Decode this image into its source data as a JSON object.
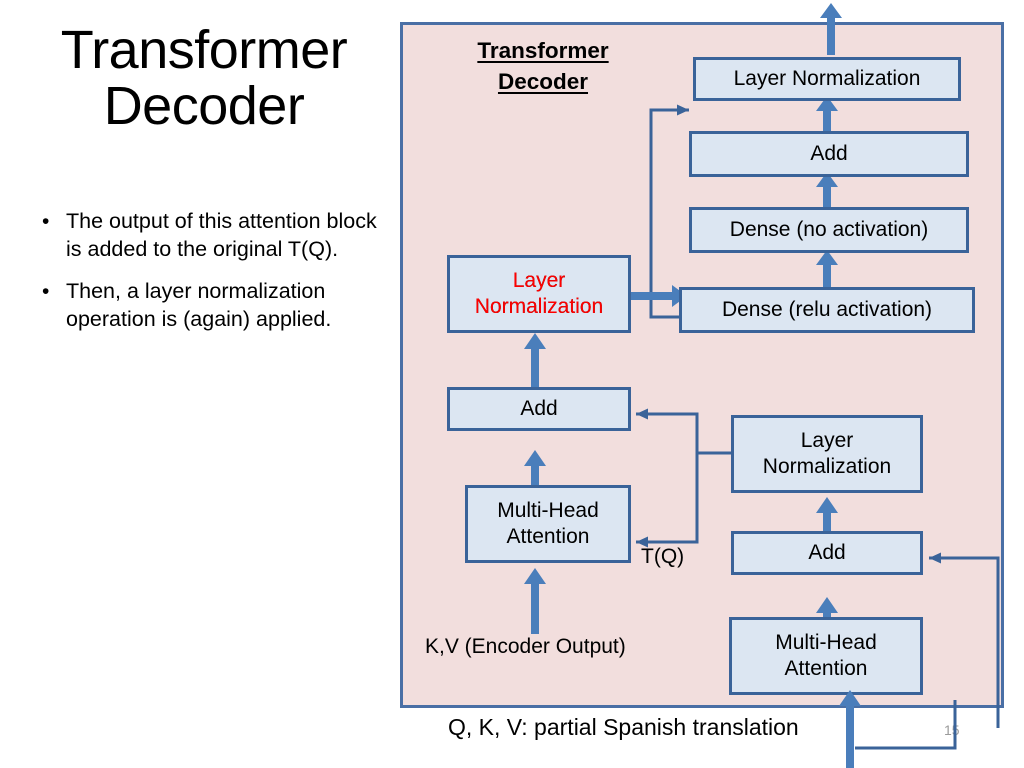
{
  "slide": {
    "title": "Transformer\nDecoder",
    "number": "15",
    "caption": "Q, K, V: partial Spanish translation",
    "bullets": [
      "The output of this attention block is added to the original T(Q).",
      "Then, a layer normalization operation is (again) applied."
    ],
    "bullet_marker": "•"
  },
  "panel": {
    "title": "Transformer\nDecoder",
    "background_color": "#f2dedd",
    "border_color": "#4a6fa5"
  },
  "colors": {
    "box_fill": "#dce6f2",
    "box_border": "#3a6399",
    "arrow": "#4a7ebb",
    "connector": "#3a6399",
    "highlight_text": "#ff0000",
    "normal_text": "#000000",
    "slide_number_text": "#9b9b9b"
  },
  "nodes": {
    "left_layer_norm": "Layer\nNormalization",
    "left_add": "Add",
    "left_multi_head_attention": "Multi-Head\nAttention",
    "top_layer_norm": "Layer Normalization",
    "top_add": "Add",
    "dense_no_activation": "Dense (no activation)",
    "dense_relu_activation": "Dense (relu activation)",
    "right_layer_norm": "Layer\nNormalization",
    "right_add": "Add",
    "right_multi_head_attention": "Multi-Head\nAttention"
  },
  "labels": {
    "t_q": "T(Q)",
    "kv_encoder_output": "K,V (Encoder Output)"
  },
  "icons": {
    "arrow_up": "arrow-up-icon",
    "arrow_right": "arrow-right-icon",
    "arrow_left": "arrow-left-icon"
  }
}
